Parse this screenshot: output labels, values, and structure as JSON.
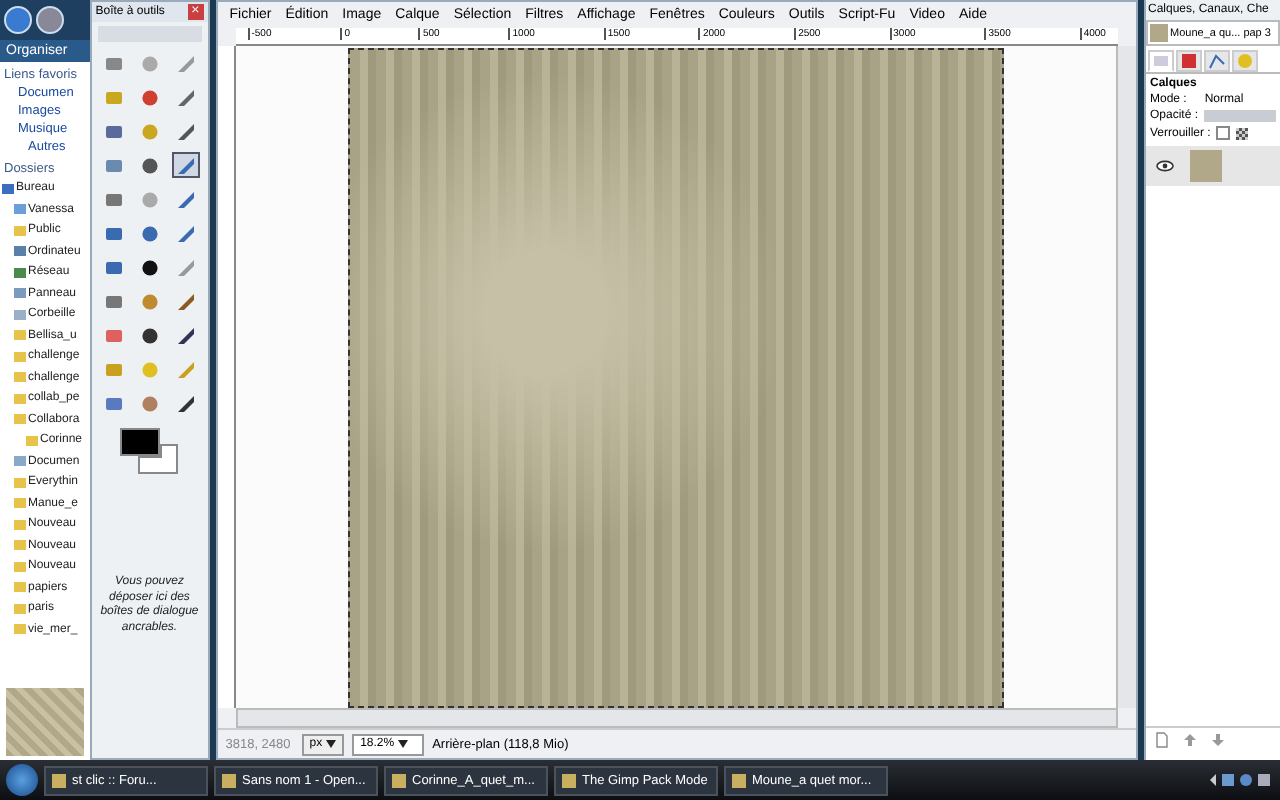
{
  "explorer": {
    "toolbar_label": "Organiser",
    "favorites_heading": "Liens favoris",
    "favorites": [
      "Documen",
      "Images",
      "Musique"
    ],
    "more": "Autres",
    "folders_heading": "Dossiers",
    "folders": [
      {
        "label": "Bureau",
        "kind": "desktop",
        "children": [
          {
            "label": "Vanessa",
            "kind": "user"
          },
          {
            "label": "Public",
            "kind": "folder"
          },
          {
            "label": "Ordinateu",
            "kind": "computer"
          },
          {
            "label": "Réseau",
            "kind": "network"
          },
          {
            "label": "Panneau",
            "kind": "panel"
          },
          {
            "label": "Corbeille",
            "kind": "trash"
          },
          {
            "label": "Bellisa_u",
            "kind": "folder"
          },
          {
            "label": "challenge",
            "kind": "folder"
          },
          {
            "label": "challenge",
            "kind": "folder"
          },
          {
            "label": "collab_pe",
            "kind": "folder"
          },
          {
            "label": "Collabora",
            "kind": "folder",
            "children": [
              {
                "label": "Corinne",
                "kind": "folder"
              }
            ]
          },
          {
            "label": "Documen",
            "kind": "docs"
          },
          {
            "label": "Everythin",
            "kind": "folder"
          },
          {
            "label": "Manue_e",
            "kind": "folder"
          },
          {
            "label": "Nouveau",
            "kind": "folder"
          },
          {
            "label": "Nouveau",
            "kind": "folder"
          },
          {
            "label": "Nouveau",
            "kind": "folder"
          },
          {
            "label": "papiers",
            "kind": "folder"
          },
          {
            "label": "paris",
            "kind": "folder"
          },
          {
            "label": "vie_mer_",
            "kind": "folder"
          }
        ]
      }
    ]
  },
  "toolbox": {
    "title": "Boîte à outils",
    "close": "×",
    "tools": [
      {
        "selected": false
      },
      {
        "selected": false
      },
      {
        "selected": false
      },
      {
        "selected": false
      },
      {
        "selected": false
      },
      {
        "selected": false
      },
      {
        "selected": false
      },
      {
        "selected": false
      },
      {
        "selected": false
      },
      {
        "selected": false
      },
      {
        "selected": false
      },
      {
        "selected": true
      },
      {
        "selected": false
      },
      {
        "selected": false
      },
      {
        "selected": false
      },
      {
        "selected": false
      },
      {
        "selected": false
      },
      {
        "selected": false
      },
      {
        "selected": false
      },
      {
        "selected": false
      },
      {
        "selected": false
      },
      {
        "selected": false
      },
      {
        "selected": false
      },
      {
        "selected": false
      },
      {
        "selected": false
      },
      {
        "selected": false
      },
      {
        "selected": false
      },
      {
        "selected": false
      },
      {
        "selected": false
      },
      {
        "selected": false
      },
      {
        "selected": false
      },
      {
        "selected": false
      },
      {
        "selected": false
      }
    ],
    "hint": "Vous pouvez déposer ici des boîtes de dialogue ancrables."
  },
  "image_window": {
    "menu": [
      "Fichier",
      "Édition",
      "Image",
      "Calque",
      "Sélection",
      "Filtres",
      "Affichage",
      "Fenêtres",
      "Couleurs",
      "Outils",
      "Script-Fu",
      "Video",
      "Aide"
    ],
    "ruler": [
      "-500",
      "0",
      "500",
      "1000",
      "1500",
      "2000",
      "2500",
      "3000",
      "3500",
      "4000"
    ],
    "status": {
      "coords": "3818, 2480",
      "unit": "px",
      "zoom": "18.2%",
      "info": "Arrière-plan (118,8 Mio)"
    }
  },
  "layers_panel": {
    "title": "Calques, Canaux, Che",
    "image": "Moune_a qu... pap 3",
    "tabs": [
      {
        "selected": true
      },
      {
        "selected": false
      },
      {
        "selected": false
      },
      {
        "selected": false
      }
    ],
    "heading": "Calques",
    "mode_label": "Mode :",
    "mode_value": "Normal",
    "opacity_label": "Opacité :",
    "opacity": {
      "level": 1
    },
    "lock_label": "Verrouiller :",
    "lock_checked": false,
    "layers": [
      {
        "visible": true,
        "selected": true
      }
    ]
  },
  "taskbar": {
    "items": [
      {
        "label": "st clic :: Foru...",
        "selected": false
      },
      {
        "label": "Sans nom 1 - Open...",
        "selected": false
      },
      {
        "label": "Corinne_A_quet_m...",
        "selected": false
      },
      {
        "label": "The Gimp Pack Mode",
        "selected": false
      },
      {
        "label": "Moune_a quet mor...",
        "selected": false
      }
    ]
  }
}
